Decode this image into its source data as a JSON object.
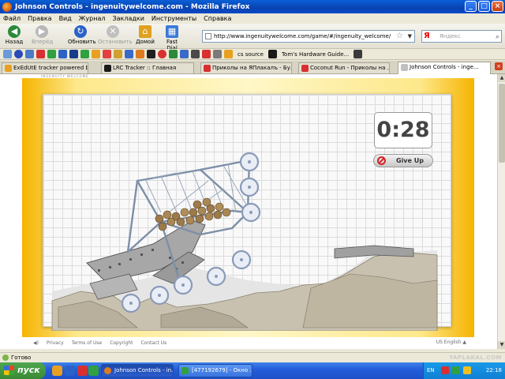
{
  "window": {
    "title": "Johnson Controls - ingenuitywelcome.com - Mozilla Firefox"
  },
  "menu": [
    "Файл",
    "Правка",
    "Вид",
    "Журнал",
    "Закладки",
    "Инструменты",
    "Справка"
  ],
  "nav": {
    "back": "Назад",
    "forward": "Вперёд",
    "reload": "Обновить",
    "stop": "Остановить",
    "home": "Домой",
    "fastdial": "Fast Dial",
    "url": "http://www.ingenuitywelcome.com/game/#/ingenuity_welcome/",
    "search_placeholder": "Яндекс",
    "search_engine": "Я"
  },
  "bookmarks": {
    "labels": [
      "cs source",
      "Tom's Hardware Guide..."
    ]
  },
  "tabs": [
    "ExEdUtE tracker powered by...",
    "LRC Tracker :: Главная",
    "Приколы на ЯПлакалъ - Бу...",
    "Coconut Run - Приколы на ...",
    "Johnson Controls - inge..."
  ],
  "content": {
    "brand": "INGENUITY WELCOME",
    "timer": "0:28",
    "give_up": "Give Up",
    "footer": {
      "links": [
        "Privacy",
        "Terms of Use",
        "Copyright",
        "Contact Us"
      ],
      "lang": "US English ▲"
    }
  },
  "status": {
    "text": "Готово"
  },
  "taskbar": {
    "start": "пуск",
    "items": [
      "Johnson Controls - in...",
      "[477192679] - Окно ..."
    ],
    "lang": "EN",
    "clock": "22:18"
  },
  "watermark": "YAPLAKAL.COM"
}
